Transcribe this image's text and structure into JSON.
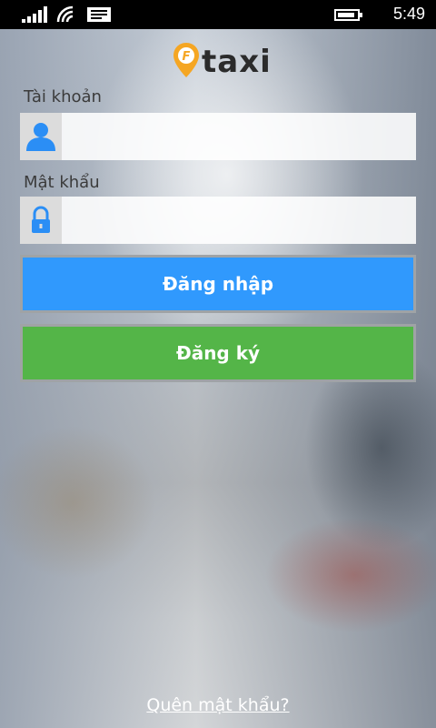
{
  "status_bar": {
    "time": "5:49"
  },
  "app": {
    "logo_text": "taxi",
    "accent_color": "#f5a623"
  },
  "form": {
    "account_label": "Tài khoản",
    "account_value": "",
    "password_label": "Mật khẩu",
    "password_value": ""
  },
  "buttons": {
    "login_label": "Đăng nhập",
    "login_color": "#3099fd",
    "register_label": "Đăng ký",
    "register_color": "#54b548"
  },
  "links": {
    "forgot_password": "Quên mật khẩu?"
  }
}
